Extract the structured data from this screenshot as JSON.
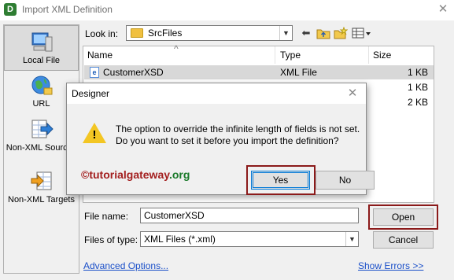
{
  "window": {
    "title": "Import XML Definition",
    "app_icon_letter": "D",
    "close_glyph": "✕"
  },
  "nav": {
    "items": [
      {
        "label": "Local File",
        "icon": "computer-icon",
        "active": true
      },
      {
        "label": "URL",
        "icon": "globe-icon",
        "active": false
      },
      {
        "label": "Non-XML Sources",
        "icon": "grid-arrow-icon",
        "active": false
      },
      {
        "label": "Non-XML Targets",
        "icon": "grid-arrow-icon",
        "active": false
      }
    ]
  },
  "lookin": {
    "label": "Look in:",
    "value": "SrcFiles",
    "arrow": "▼"
  },
  "toolbar": {
    "back": "⬅",
    "up_folder": "📁",
    "new_folder": "✱",
    "view_menu": "▦▾"
  },
  "filelist": {
    "columns": [
      "Name",
      "Type",
      "Size"
    ],
    "sort_glyph": "^",
    "rows": [
      {
        "name": "CustomerXSD",
        "type": "XML File",
        "size": "1 KB",
        "selected": true
      },
      {
        "name": "",
        "type": "",
        "size": "1 KB",
        "selected": false
      },
      {
        "name": "",
        "type": "",
        "size": "2 KB",
        "selected": false
      }
    ]
  },
  "form": {
    "file_name_label": "File name:",
    "file_name_value": "CustomerXSD",
    "file_type_label": "Files of type:",
    "file_type_value": "XML Files (*.xml)",
    "arrow": "▼",
    "open_label": "Open",
    "cancel_label": "Cancel",
    "advanced_link": "Advanced Options...",
    "errors_link": "Show Errors >>"
  },
  "message": {
    "title": "Designer",
    "line1": "The option to override the infinite length of fields is not set.",
    "line2": "Do you want to set it before you import the definition?",
    "yes_label": "Yes",
    "no_label": "No",
    "watermark_prefix": "©tutorial",
    "watermark_mid": "gateway",
    "watermark_suffix": ".org"
  },
  "colors": {
    "highlight_box": "#8b1a1a",
    "link": "#1a4fc9",
    "warning": "#f3c623",
    "selection": "#d8d8d8"
  }
}
